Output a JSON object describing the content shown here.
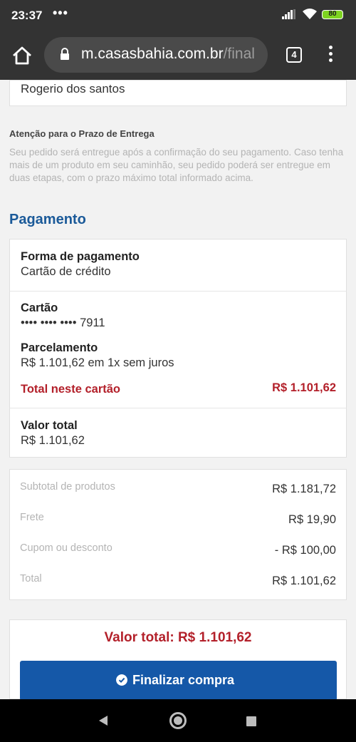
{
  "status_bar": {
    "time": "23:37",
    "notif_dots": "•••",
    "battery": "80"
  },
  "browser": {
    "url_domain": "m.casasbahia.com.br",
    "url_path": "/final",
    "tab_count": "4"
  },
  "recipient": {
    "name": "Rogerio dos santos"
  },
  "delivery_notice": {
    "title": "Atenção para o Prazo de Entrega",
    "text": "Seu pedido será entregue após a confirmação do seu pagamento. Caso tenha mais de um produto em seu caminhão, seu pedido poderá ser entregue em duas etapas, com o prazo máximo total informado acima."
  },
  "payment": {
    "section_title": "Pagamento",
    "method_label": "Forma de pagamento",
    "method_value": "Cartão de crédito",
    "card_label": "Cartão",
    "card_number": "•••• •••• •••• 7911",
    "installments_label": "Parcelamento",
    "installments_value": "R$ 1.101,62 em 1x sem juros",
    "card_total_label": "Total neste cartão",
    "card_total_value": "R$ 1.101,62",
    "grand_total_label": "Valor total",
    "grand_total_value": "R$ 1.101,62"
  },
  "summary": {
    "rows": [
      {
        "label": "Subtotal de produtos",
        "value": "R$ 1.181,72"
      },
      {
        "label": "Frete",
        "value": "R$ 19,90"
      },
      {
        "label": "Cupom ou desconto",
        "value": "- R$ 100,00"
      },
      {
        "label": "Total",
        "value": "R$ 1.101,62"
      }
    ]
  },
  "checkout": {
    "total_text": "Valor total: R$ 1.101,62",
    "finalize_label": "Finalizar compra",
    "button_color": "#1558a8",
    "price_color": "#b3202a"
  }
}
